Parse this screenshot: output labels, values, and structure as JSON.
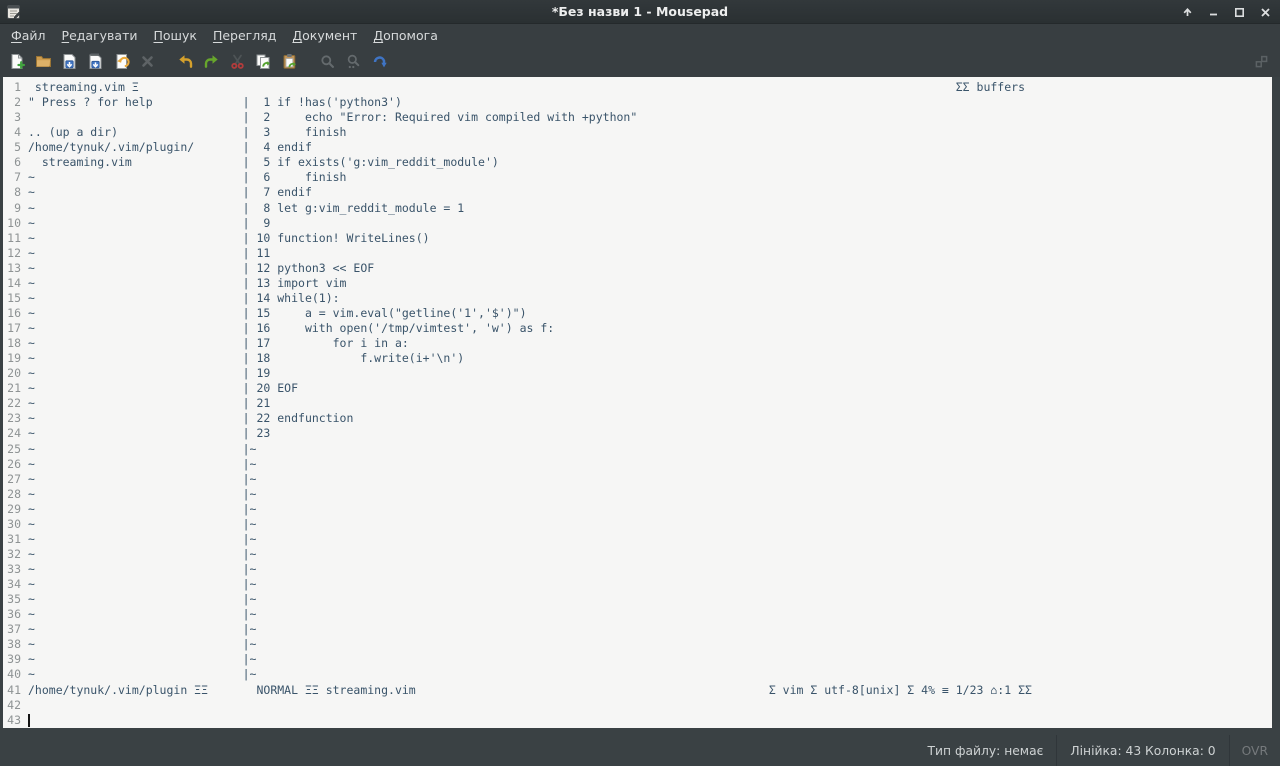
{
  "window": {
    "title": "*Без назви 1 - Mousepad",
    "controls": [
      {
        "name": "shade",
        "icon": "arrow-up-icon"
      },
      {
        "name": "minimize",
        "icon": "minus-icon"
      },
      {
        "name": "maximize",
        "icon": "square-icon"
      },
      {
        "name": "close",
        "icon": "x-icon"
      }
    ]
  },
  "menu": {
    "items": [
      {
        "mnemonic": "Ф",
        "rest": "айл"
      },
      {
        "mnemonic": "Р",
        "rest": "едагувати"
      },
      {
        "mnemonic": "П",
        "rest": "ошук"
      },
      {
        "mnemonic": "П",
        "rest": "ерегляд"
      },
      {
        "mnemonic": "Д",
        "rest": "окумент"
      },
      {
        "mnemonic": "Д",
        "rest": "опомога"
      }
    ]
  },
  "toolbar": {
    "buttons": [
      {
        "name": "new-document",
        "icon": "new-document-icon",
        "enabled": true
      },
      {
        "name": "open-file",
        "icon": "open-folder-icon",
        "enabled": true
      },
      {
        "name": "save",
        "icon": "save-icon",
        "enabled": true
      },
      {
        "name": "save-as",
        "icon": "save-as-icon",
        "enabled": true
      },
      {
        "name": "revert",
        "icon": "revert-icon",
        "enabled": true
      },
      {
        "name": "close-file",
        "icon": "close-x-icon",
        "enabled": false
      },
      {
        "name": "undo",
        "icon": "undo-arrow-icon",
        "enabled": true
      },
      {
        "name": "redo",
        "icon": "redo-arrow-icon",
        "enabled": true
      },
      {
        "name": "cut",
        "icon": "scissors-icon",
        "enabled": true
      },
      {
        "name": "copy",
        "icon": "copy-pages-icon",
        "enabled": true
      },
      {
        "name": "paste",
        "icon": "clipboard-icon",
        "enabled": true
      },
      {
        "name": "find",
        "icon": "magnifier-icon",
        "enabled": false
      },
      {
        "name": "find-replace",
        "icon": "magnifier-replace-icon",
        "enabled": false
      },
      {
        "name": "go-to-line",
        "icon": "blue-jump-arrow-icon",
        "enabled": true
      },
      {
        "name": "fullscreen",
        "icon": "fullscreen-icon",
        "enabled": false
      }
    ]
  },
  "vim_screen": {
    "tabline": {
      "tab": " streaming.vim Ξ",
      "right": "ΣΣ buffers"
    },
    "nerdtree_lines": [
      "\" Press ? for help",
      "",
      ".. (up a dir)",
      "/home/tynuk/.vim/plugin/",
      "  streaming.vim"
    ],
    "fill_char": "~",
    "buffer_lines": [
      "if !has('python3')",
      "    echo \"Error: Required vim compiled with +python\"",
      "    finish",
      "endif",
      "if exists('g:vim_reddit_module')",
      "    finish",
      "endif",
      "let g:vim_reddit_module = 1",
      "",
      "function! WriteLines()",
      "",
      "python3 << EOF",
      "import vim",
      "while(1):",
      "    a = vim.eval(\"getline('1','$')\")",
      "    with open('/tmp/vimtest', 'w') as f:",
      "        for i in a:",
      "            f.write(i+'\\n')",
      "",
      "EOF",
      "",
      "endfunction",
      ""
    ],
    "statusline": {
      "left": "/home/tynuk/.vim/plugin ΞΞ",
      "mode": "NORMAL ΞΞ streaming.vim",
      "right": "Σ vim Σ utf-8[unix] Σ 4% ≡ 1/23 ⌂:1 ΣΣ"
    },
    "columns": {
      "display_rows": 39,
      "split_col": 31,
      "mode_col": 33,
      "status_right_col": 107,
      "tabline_right_col": 134
    },
    "trailing_blank_lines": 2,
    "total_lines": 43,
    "cursor": {
      "line": 43,
      "column": 0
    }
  },
  "statusbar": {
    "filetype": "Тип файлу: немає",
    "position": "Лінійка: 43 Колонка: 0",
    "overwrite": "OVR"
  },
  "colors": {
    "chrome_bg": "#383e41",
    "titlebar_bg": "#2e3436",
    "editor_bg": "#f6f6f5",
    "editor_text": "#3a546a",
    "gutter_text": "#8e9394",
    "accent_blue": "#3f74c4",
    "accent_green": "#55a32f",
    "accent_gold": "#d4a02c",
    "accent_orange": "#e9a93d",
    "folder_tan": "#cd9c4f"
  }
}
